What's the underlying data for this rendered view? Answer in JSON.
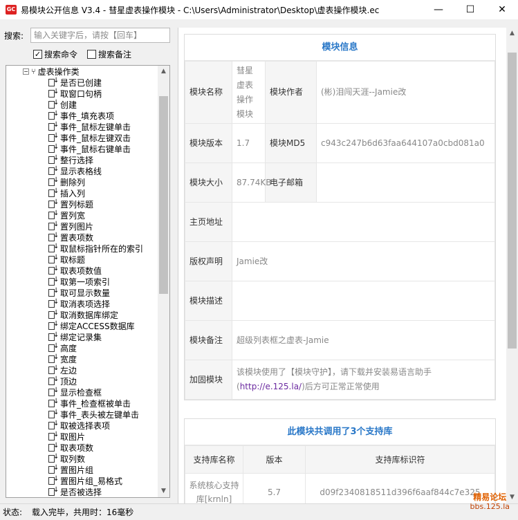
{
  "window": {
    "title": "易模块公开信息 V3.4 - 彗星虚表操作模块 - C:\\Users\\Administrator\\Desktop\\虚表操作模块.ec",
    "app_icon": "GC",
    "minimize": "—",
    "maximize": "☐",
    "close": "✕"
  },
  "search": {
    "label": "搜索:",
    "placeholder": "输入关键字后，请按【回车】",
    "value": "",
    "opt_command": {
      "label": "搜索命令",
      "checked": true
    },
    "opt_note": {
      "label": "搜索备注",
      "checked": false
    }
  },
  "tree": {
    "root": {
      "expander": "⊟",
      "icon": "fork-icon",
      "label": "虚表操作类"
    },
    "items": [
      "是否已创建",
      "取窗口句柄",
      "创建",
      "事件_填充表项",
      "事件_鼠标左键单击",
      "事件_鼠标左键双击",
      "事件_鼠标右键单击",
      "整行选择",
      "显示表格线",
      "删除列",
      "插入列",
      "置列标题",
      "置列宽",
      "置列图片",
      "置表项数",
      "取鼠标指针所在的索引",
      "取标题",
      "取表项数值",
      "取第一项索引",
      "取可显示数量",
      "取消表项选择",
      "取消数据库绑定",
      "绑定ACCESS数据库",
      "绑定记录集",
      "高度",
      "宽度",
      "左边",
      "顶边",
      "显示检查框",
      "事件_检查框被单击",
      "事件_表头被左键单击",
      "取被选择表项",
      "取图片",
      "取表项数",
      "取列数",
      "置图片组",
      "置图片组_易格式",
      "是否被选择"
    ]
  },
  "module_info": {
    "title": "模块信息",
    "name_label": "模块名称",
    "name_value": "彗星虚表操作模块",
    "author_label": "模块作者",
    "author_value": "(彬)泪闯天涯--Jamie改",
    "version_label": "模块版本",
    "version_value": "1.7",
    "md5_label": "模块MD5",
    "md5_value": "c943c247b6d63faa644107a0cbd081a0",
    "size_label": "模块大小",
    "size_value": "87.74KB",
    "email_label": "电子邮箱",
    "email_value": "",
    "homepage_label": "主页地址",
    "homepage_value": "",
    "copyright_label": "版权声明",
    "copyright_value": "Jamie改",
    "desc_label": "模块描述",
    "desc_value": "",
    "note_label": "模块备注",
    "note_value": "超级列表框之虚表-Jamie",
    "protect_label": "加固模块",
    "protect_text_before": "该模块使用了【模块守护】，请下载并安装易语言助手(",
    "protect_link": "http://e.125.la/",
    "protect_text_after": ")后方可正常正常使用"
  },
  "support": {
    "title": "此模块共调用了3个支持库",
    "col_name": "支持库名称",
    "col_version": "版本",
    "col_id": "支持库标识符",
    "rows": [
      {
        "name": "系统核心支持库[krnln]",
        "version": "5.7",
        "id": "d09f2340818511d396f6aaf844c7e325"
      }
    ]
  },
  "status": {
    "label": "状态:",
    "text": "载入完毕，共用时：16毫秒"
  },
  "watermark": {
    "line1": "精易论坛",
    "line2": "bbs.125.la"
  }
}
